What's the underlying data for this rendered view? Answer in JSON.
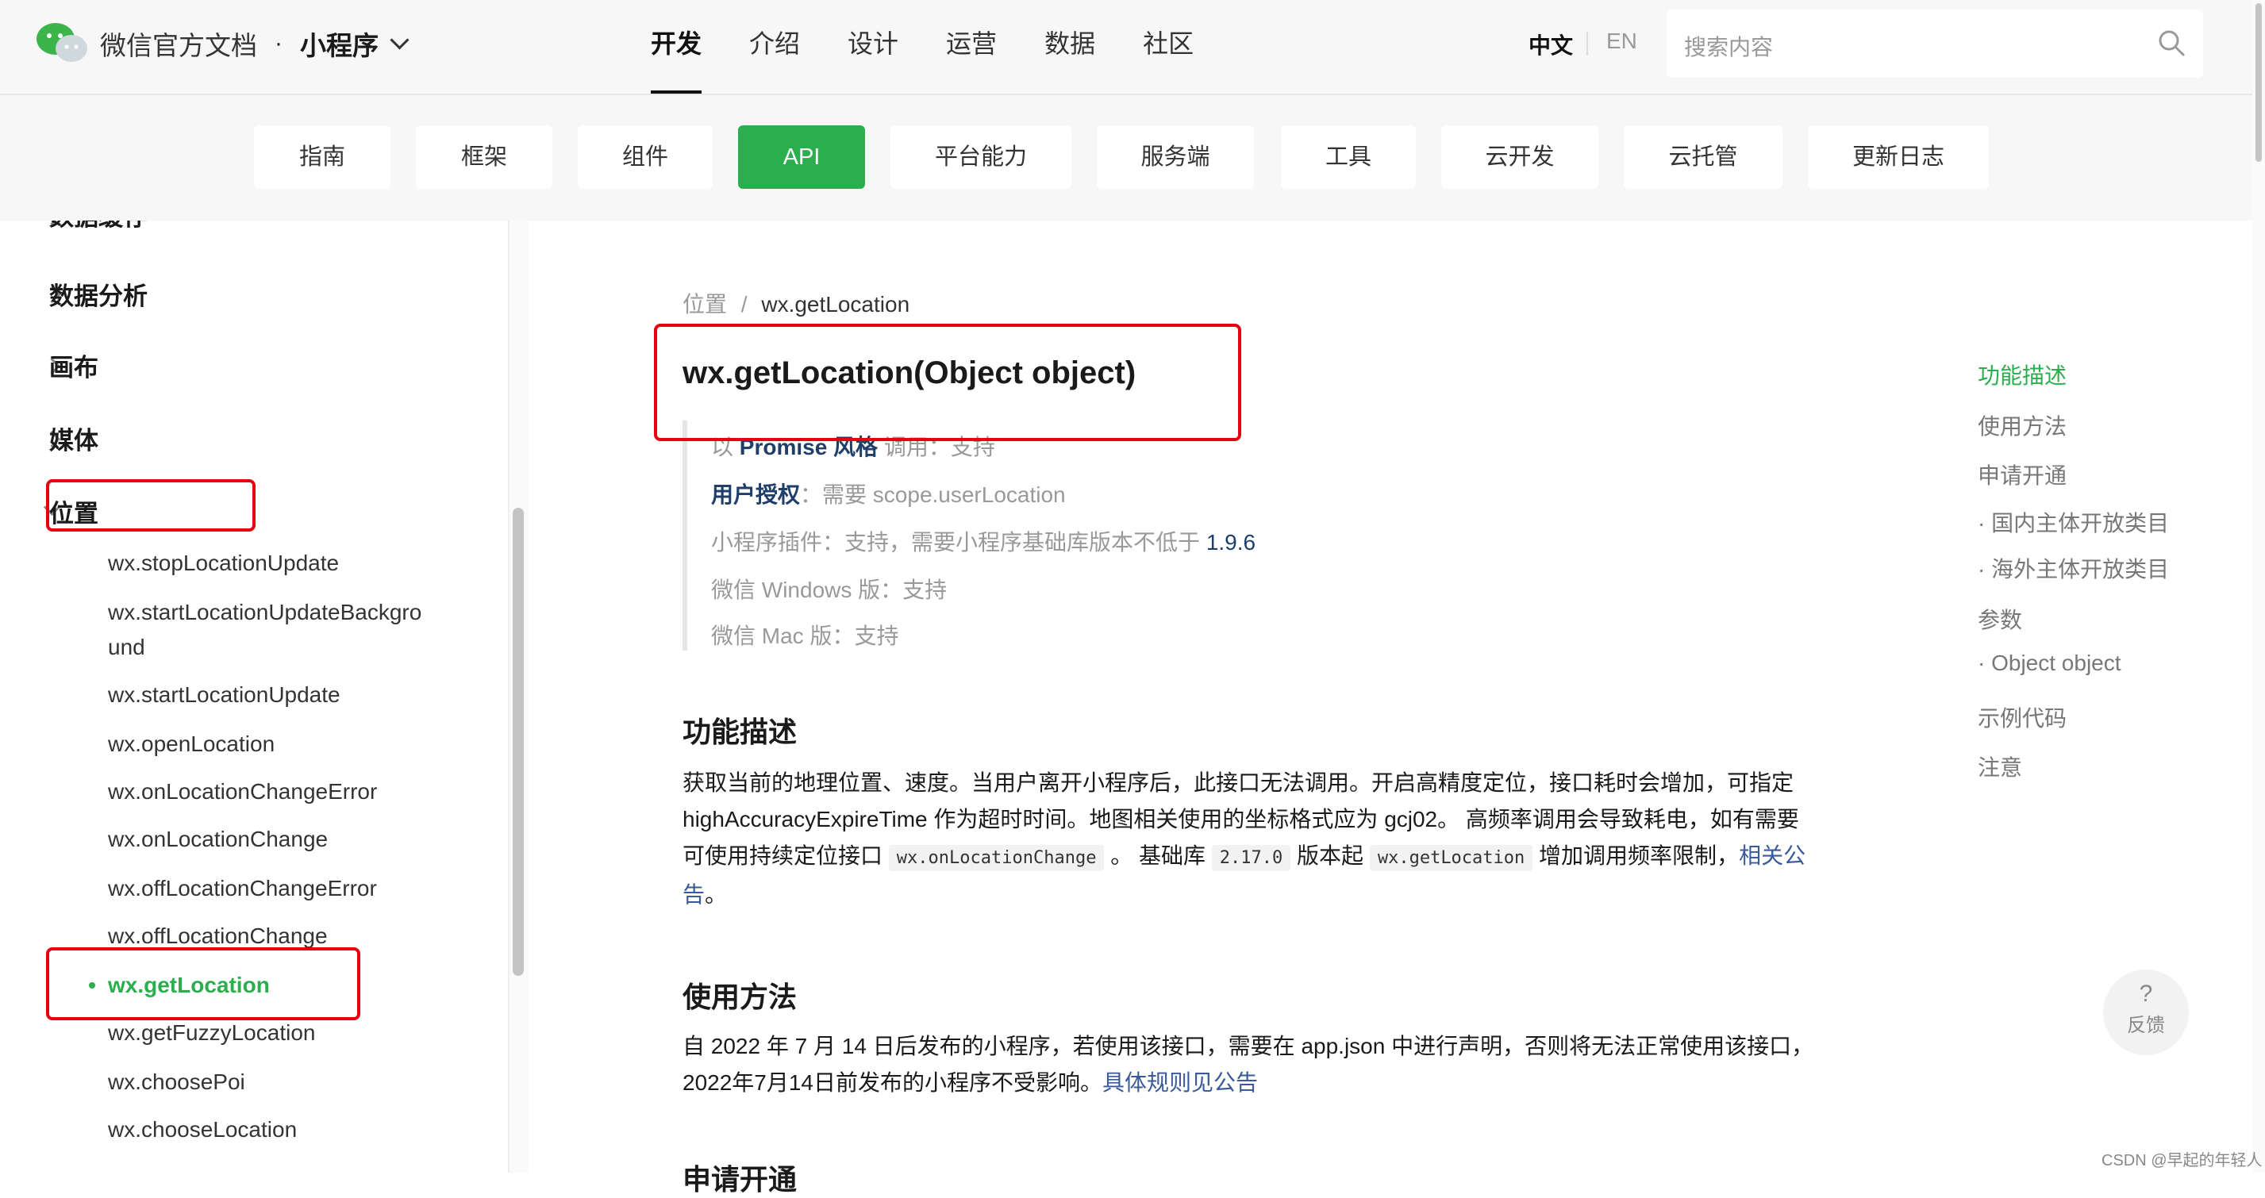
{
  "header": {
    "brand": "微信官方文档",
    "separator": "·",
    "product": "小程序",
    "nav": [
      "开发",
      "介绍",
      "设计",
      "运营",
      "数据",
      "社区"
    ],
    "lang_zh": "中文",
    "lang_en": "EN",
    "search_placeholder": "搜索内容"
  },
  "subnav": [
    "指南",
    "框架",
    "组件",
    "API",
    "平台能力",
    "服务端",
    "工具",
    "云开发",
    "云托管",
    "更新日志"
  ],
  "sidebar": {
    "cutoff_group": "数据缓存",
    "groups": [
      "数据分析",
      "画布",
      "媒体",
      "位置"
    ],
    "links": [
      "wx.stopLocationUpdate",
      "wx.startLocationUpdateBackground",
      "wx.startLocationUpdate",
      "wx.openLocation",
      "wx.onLocationChangeError",
      "wx.onLocationChange",
      "wx.offLocationChangeError",
      "wx.offLocationChange",
      "wx.getLocation",
      "wx.getFuzzyLocation",
      "wx.choosePoi",
      "wx.chooseLocation"
    ],
    "link_bgu_line1": "wx.startLocationUpdateBackgro",
    "link_bgu_line2": "und"
  },
  "breadcrumb": {
    "parent": "位置",
    "sep": "/",
    "current": "wx.getLocation"
  },
  "title": "wx.getLocation(Object object)",
  "meta": {
    "promise_prefix": "以 ",
    "promise_link": "Promise 风格",
    "promise_suffix": " 调用：支持",
    "auth_label": "用户授权",
    "auth_value": "：需要 scope.userLocation",
    "plugin_label": "小程序插件",
    "plugin_value": "：支持，需要小程序基础库版本不低于 ",
    "plugin_version": "1.9.6",
    "windows_label": "微信 Windows 版",
    "windows_value": "：支持",
    "mac_label": "微信 Mac 版",
    "mac_value": "：支持"
  },
  "section1": {
    "heading": "功能描述",
    "line1": "获取当前的地理位置、速度。当用户离开小程序后，此接口无法调用。开启高精度定位，接口耗时会增加，可指定",
    "line2": "highAccuracyExpireTime 作为超时时间。地图相关使用的坐标格式应为 gcj02。 高频率调用会导致耗电，如有需要",
    "line3_a": "可使用持续定位接口 ",
    "code1": "wx.onLocationChange",
    "line3_b": " 。 基础库 ",
    "code2": "2.17.0",
    "line3_c": " 版本起 ",
    "code3": "wx.getLocation",
    "line3_d": " 增加调用频率限制，",
    "link_a": "相关公",
    "line4_link": "告",
    "line4_tail": "。"
  },
  "section2": {
    "heading": "使用方法",
    "line1": "自 2022 年 7 月 14 日后发布的小程序，若使用该接口，需要在 app.json 中进行声明，否则将无法正常使用该接口，",
    "line2": "2022年7月14日前发布的小程序不受影响。",
    "link": "具体规则见公告"
  },
  "section3": {
    "heading": "申请开通"
  },
  "toc": [
    "功能描述",
    "使用方法",
    "申请开通",
    "· 国内主体开放类目",
    "· 海外主体开放类目",
    "参数",
    "· Object object",
    "示例代码",
    "注意"
  ],
  "feedback": {
    "icon": "?",
    "label": "反馈"
  },
  "watermark": "CSDN @早起的年轻人",
  "colors": {
    "accent": "#2aae4e",
    "annotation": "#e60012",
    "link": "#3a5a9c"
  }
}
